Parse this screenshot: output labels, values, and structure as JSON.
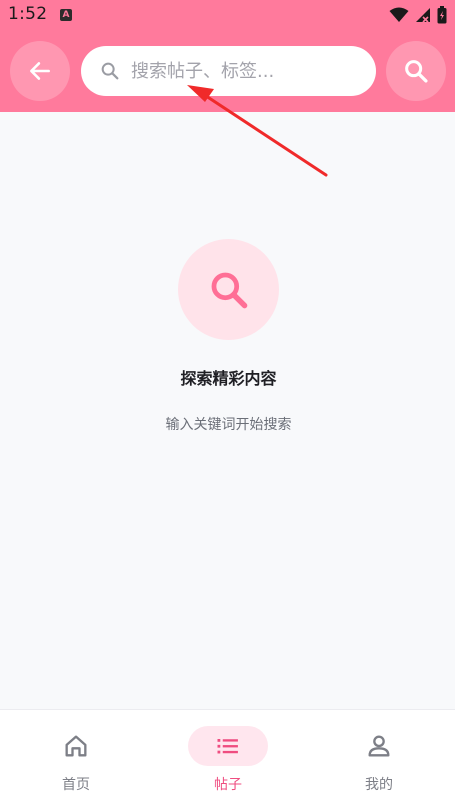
{
  "status_bar": {
    "time": "1:52",
    "app_badge": "A"
  },
  "header": {
    "search": {
      "placeholder": "搜索帖子、标签...",
      "value": ""
    }
  },
  "empty_state": {
    "title": "探索精彩内容",
    "subtitle": "输入关键词开始搜索"
  },
  "bottom_nav": {
    "items": [
      {
        "label": "首页",
        "icon": "home-icon",
        "active": false
      },
      {
        "label": "帖子",
        "icon": "list-icon",
        "active": true
      },
      {
        "label": "我的",
        "icon": "person-icon",
        "active": false
      }
    ]
  },
  "colors": {
    "header_pink": "#ff7a9c",
    "accent": "#ef4d80",
    "annotation_red": "#f02a2a"
  }
}
